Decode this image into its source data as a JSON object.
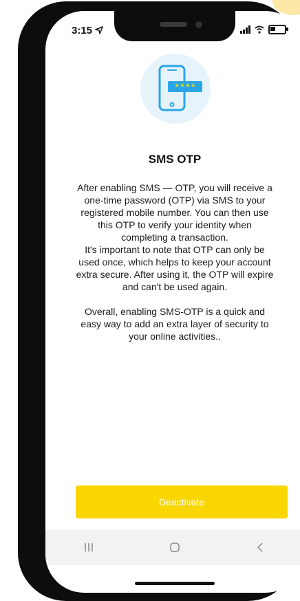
{
  "status_bar": {
    "time": "3:15"
  },
  "page": {
    "title": "SMS OTP",
    "paragraph_1_lines": [
      "After enabling SMS — OTP, you will receive a",
      "one-time password (OTP) via SMS to your",
      "registered mobile number. You can then use",
      "this OTP to verify your identity when",
      "completing a transaction.",
      "It's important to note that OTP can only be",
      "used once, which helps to keep your account",
      "extra secure. After using it, the OTP will expire",
      "and can't be used again."
    ],
    "paragraph_2_lines": [
      "Overall, enabling SMS-OTP is a quick and",
      "easy way to add an extra layer of security to",
      "your online activities.."
    ],
    "hero_otp_mask": "****"
  },
  "actions": {
    "deactivate_label": "Deactivate"
  },
  "nav": {
    "recent_icon": "recent-apps-icon",
    "home_icon": "home-icon",
    "back_icon": "back-icon"
  },
  "colors": {
    "accent": "#f9d600",
    "icon_blue": "#2aa6e8",
    "hero_bg": "#e6f3fb"
  }
}
